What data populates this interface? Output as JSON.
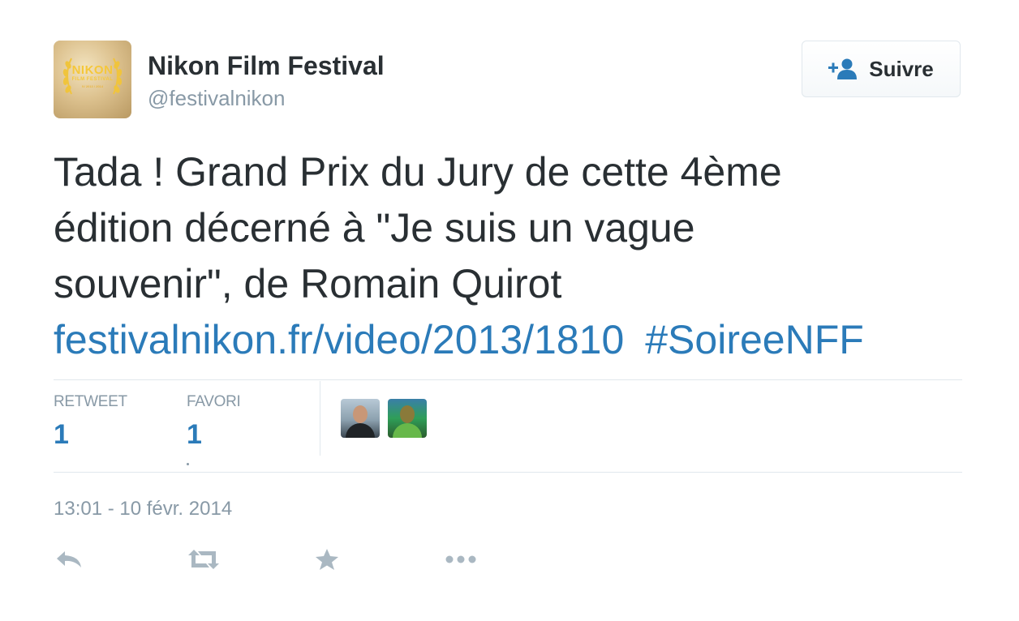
{
  "author": {
    "display_name": "Nikon Film Festival",
    "handle": "@festivalnikon",
    "avatar_logo": {
      "line1": "NIKON",
      "line2": "FILM FESTIVAL",
      "line3": "IV 2013 / 2014"
    }
  },
  "follow_button": {
    "label": "Suivre",
    "icon": "add-user-icon"
  },
  "tweet": {
    "text_lines": [
      "Tada ! Grand Prix du Jury de cette 4ème",
      "édition décerné à \"Je suis un vague",
      "souvenir\", de Romain Quirot"
    ],
    "link": "festivalnikon.fr/video/2013/1810",
    "hashtag": "#SoireeNFF"
  },
  "stats": {
    "retweets": {
      "label": "RETWEET",
      "count": "1"
    },
    "favorites": {
      "label": "FAVORI",
      "count": "1"
    }
  },
  "favorited_by_avatars": [
    "user-avatar-1",
    "user-avatar-2"
  ],
  "timestamp": "13:01 - 10 févr. 2014",
  "actions": [
    "reply-icon",
    "retweet-icon",
    "favorite-icon",
    "more-icon"
  ],
  "colors": {
    "text": "#292f33",
    "muted": "#8899a6",
    "link": "#2b7bb9",
    "divider": "#e1e8ed",
    "action_icon": "#aab8c2"
  }
}
